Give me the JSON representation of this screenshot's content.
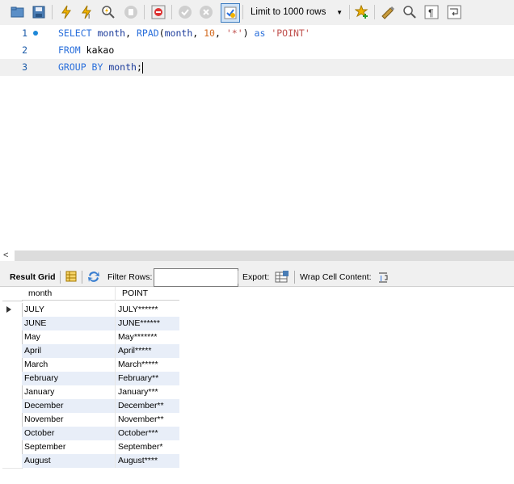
{
  "toolbar": {
    "limit_label": "Limit to 1000 rows",
    "icons": [
      "open-file-icon",
      "save-icon",
      "execute-icon",
      "execute-current-icon",
      "explain-icon",
      "stop-icon",
      "toggle-error-icon",
      "commit-icon",
      "rollback-icon",
      "autocommit-icon",
      "favorite-icon",
      "beautify-icon",
      "find-icon",
      "invisible-chars-icon",
      "wrap-icon"
    ]
  },
  "editor": {
    "lines": [
      {
        "num": "1"
      },
      {
        "num": "2"
      },
      {
        "num": "3"
      }
    ],
    "tokens": {
      "select": "SELECT",
      "month1": "month",
      "comma1": ",",
      "rpad": "RPAD",
      "paren_open": "(",
      "month2": "month",
      "comma2": ",",
      "ten": "10",
      "comma3": ",",
      "star": "'*'",
      "paren_close": ")",
      "as": "as",
      "alias": "'POINT'",
      "from": "FROM",
      "table": "kakao",
      "group_by": "GROUP BY",
      "month3": "month",
      "semicolon": ";"
    }
  },
  "result_toolbar": {
    "result_grid": "Result Grid",
    "filter_rows": "Filter Rows:",
    "filter_value": "",
    "export": "Export:",
    "wrap_cell": "Wrap Cell Content:"
  },
  "grid": {
    "columns": [
      "month",
      "POINT"
    ],
    "rows": [
      [
        "JULY",
        "JULY******"
      ],
      [
        "JUNE",
        "JUNE******"
      ],
      [
        "May",
        "May*******"
      ],
      [
        "April",
        "April*****"
      ],
      [
        "March",
        "March*****"
      ],
      [
        "February",
        "February**"
      ],
      [
        "January",
        "January***"
      ],
      [
        "December",
        "December**"
      ],
      [
        "November",
        "November**"
      ],
      [
        "October",
        "October***"
      ],
      [
        "September",
        "September*"
      ],
      [
        "August",
        "August****"
      ]
    ]
  },
  "colors": {
    "keyword": "#2a6fdb",
    "string": "#c0504d",
    "number": "#d2691e",
    "row_alt": "#e8eef8"
  }
}
